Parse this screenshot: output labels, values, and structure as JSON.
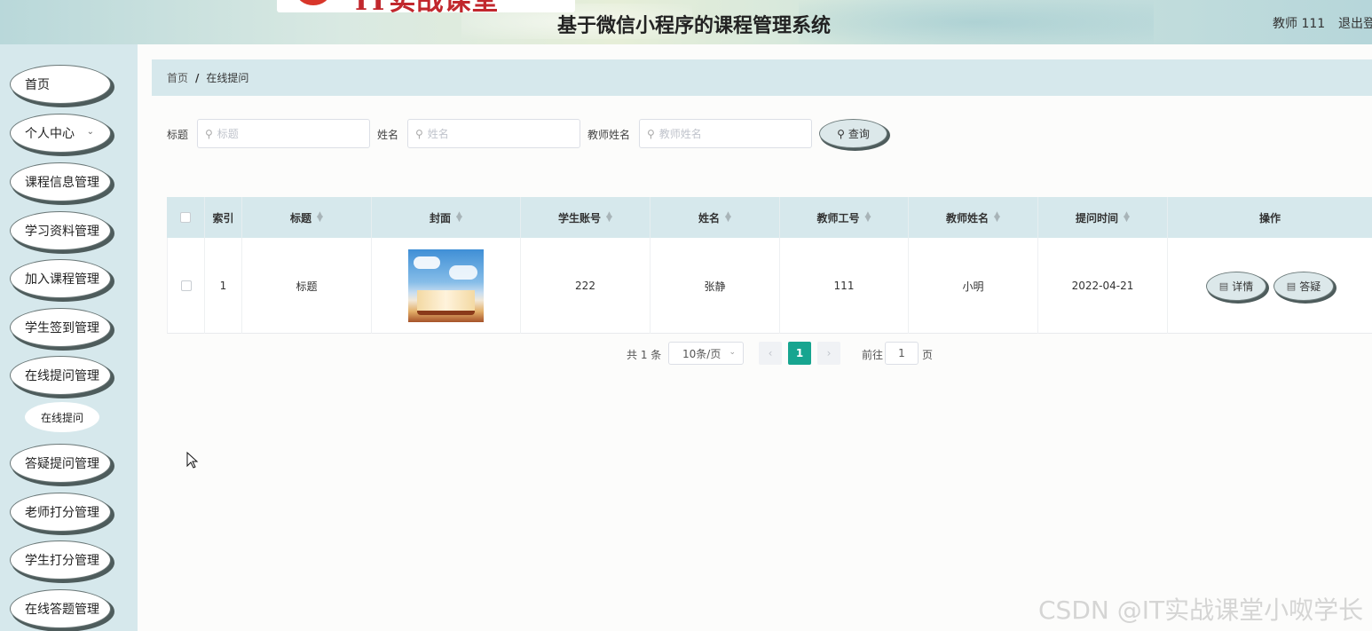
{
  "header": {
    "logo_text": "IT实战课堂",
    "title": "基于微信小程序的课程管理系统",
    "user": "教师 111",
    "logout": "退出登录"
  },
  "sidebar": {
    "items": [
      {
        "label": "首页"
      },
      {
        "label": "个人中心",
        "has_chevron": true
      },
      {
        "label": "课程信息管理"
      },
      {
        "label": "学习资料管理"
      },
      {
        "label": "加入课程管理"
      },
      {
        "label": "学生签到管理"
      },
      {
        "label": "在线提问管理"
      },
      {
        "label": "答疑提问管理"
      },
      {
        "label": "老师打分管理"
      },
      {
        "label": "学生打分管理"
      },
      {
        "label": "在线答题管理"
      }
    ],
    "sub_item": "在线提问"
  },
  "breadcrumb": {
    "home": "首页",
    "sep": "/",
    "current": "在线提问"
  },
  "search": {
    "title_label": "标题",
    "title_placeholder": "标题",
    "name_label": "姓名",
    "name_placeholder": "姓名",
    "teacher_label": "教师姓名",
    "teacher_placeholder": "教师姓名",
    "query_button": "查询"
  },
  "table": {
    "columns": [
      "索引",
      "标题",
      "封面",
      "学生账号",
      "姓名",
      "教师工号",
      "教师姓名",
      "提问时间",
      "操作"
    ],
    "rows": [
      {
        "index": "1",
        "title": "标题",
        "cover": "book-cover-image",
        "student_account": "222",
        "name": "张静",
        "teacher_id": "111",
        "teacher_name": "小明",
        "ask_time": "2022-04-21",
        "detail_button": "详情",
        "answer_button": "答疑"
      }
    ]
  },
  "pagination": {
    "total": "共 1 条",
    "page_size": "10条/页",
    "prev": "‹",
    "current": "1",
    "next": "›",
    "goto_label": "前往",
    "goto_value": "1",
    "page_unit": "页"
  },
  "watermark": "CSDN @IT实战课堂小呶学长",
  "colors": {
    "sidebar_bg": "#d6e8ec",
    "accent": "#17a590",
    "button_border": "#4e5c5c"
  }
}
